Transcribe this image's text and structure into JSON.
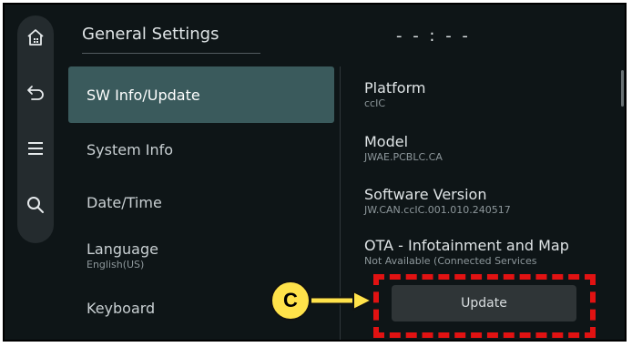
{
  "header": {
    "title": "General Settings",
    "clock": "- - : - -"
  },
  "rail": {
    "items": [
      {
        "icon": "home-icon"
      },
      {
        "icon": "back-icon"
      },
      {
        "icon": "menu-icon"
      },
      {
        "icon": "search-icon"
      }
    ]
  },
  "menu": {
    "items": [
      {
        "label": "SW Info/Update",
        "active": true
      },
      {
        "label": "System Info"
      },
      {
        "label": "Date/Time"
      },
      {
        "label": "Language",
        "sub": "English(US)"
      },
      {
        "label": "Keyboard"
      }
    ]
  },
  "detail": {
    "items": [
      {
        "title": "Platform",
        "value": "ccIC"
      },
      {
        "title": "Model",
        "value": "JWAE.PCBLC.CA"
      },
      {
        "title": "Software Version",
        "value": "JW.CAN.ccIC.001.010.240517"
      },
      {
        "title": "OTA - Infotainment and Map",
        "value": "Not Available (Connected Services"
      }
    ],
    "update_label": "Update"
  },
  "callout": {
    "letter": "C"
  },
  "colors": {
    "screen_bg": "#0e1517",
    "active_item": "#3a5a5c",
    "callout_fill": "#ffe24a",
    "highlight": "#e11212"
  }
}
